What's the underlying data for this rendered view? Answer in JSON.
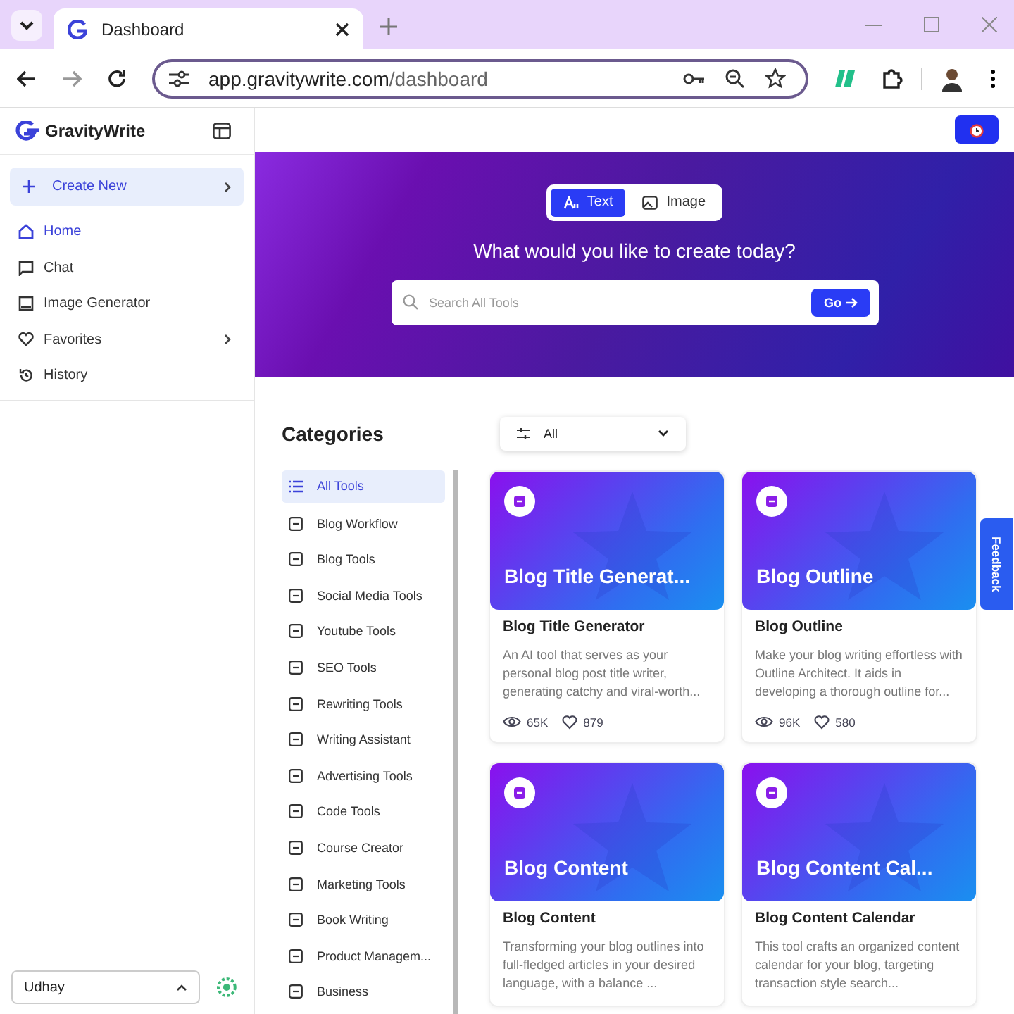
{
  "browser": {
    "tab_title": "Dashboard",
    "url_host": "app.gravitywrite.com",
    "url_path": "/dashboard"
  },
  "sidebar": {
    "logo": "GravityWrite",
    "create_new": "Create New",
    "items": [
      {
        "label": "Home",
        "selected": true,
        "expandable": false
      },
      {
        "label": "Chat",
        "selected": false,
        "expandable": false
      },
      {
        "label": "Image Generator",
        "selected": false,
        "expandable": false
      },
      {
        "label": "Favorites",
        "selected": false,
        "expandable": true
      },
      {
        "label": "History",
        "selected": false,
        "expandable": false
      }
    ],
    "user": "Udhay"
  },
  "hero": {
    "modes": [
      {
        "label": "Text",
        "selected": true
      },
      {
        "label": "Image",
        "selected": false
      }
    ],
    "heading": "What would you like to create today?",
    "search": {
      "placeholder": "Search All Tools"
    },
    "go_button": "Go"
  },
  "categories": {
    "title": "Categories",
    "filter": "All",
    "items": [
      {
        "label": "All Tools",
        "selected": true
      },
      {
        "label": "Blog Workflow",
        "selected": false
      },
      {
        "label": "Blog Tools",
        "selected": false
      },
      {
        "label": "Social Media Tools",
        "selected": false
      },
      {
        "label": "Youtube Tools",
        "selected": false
      },
      {
        "label": "SEO Tools",
        "selected": false
      },
      {
        "label": "Rewriting Tools",
        "selected": false
      },
      {
        "label": "Writing Assistant",
        "selected": false
      },
      {
        "label": "Advertising Tools",
        "selected": false
      },
      {
        "label": "Code Tools",
        "selected": false
      },
      {
        "label": "Course Creator",
        "selected": false
      },
      {
        "label": "Marketing Tools",
        "selected": false
      },
      {
        "label": "Book Writing",
        "selected": false
      },
      {
        "label": "Product Managem...",
        "selected": false
      },
      {
        "label": "Business",
        "selected": false
      }
    ]
  },
  "cards": [
    {
      "banner_title": "Blog Title Generat...",
      "title": "Blog Title Generator",
      "description": "An AI tool that serves as your personal blog post title writer, generating catchy and viral-worth...",
      "views": "65K",
      "likes": "879"
    },
    {
      "banner_title": "Blog Outline",
      "title": "Blog Outline",
      "description": "Make your blog writing effortless with Outline Architect. It aids in developing a thorough outline for...",
      "views": "96K",
      "likes": "580"
    },
    {
      "banner_title": "Blog Content",
      "title": "Blog Content",
      "description": "Transforming your blog outlines into full-fledged articles in your desired language, with a balance ..."
    },
    {
      "banner_title": "Blog Content Cal...",
      "title": "Blog Content Calendar",
      "description": "This tool crafts an organized content calendar for your blog, targeting transaction style search..."
    }
  ],
  "feedback": "Feedback"
}
